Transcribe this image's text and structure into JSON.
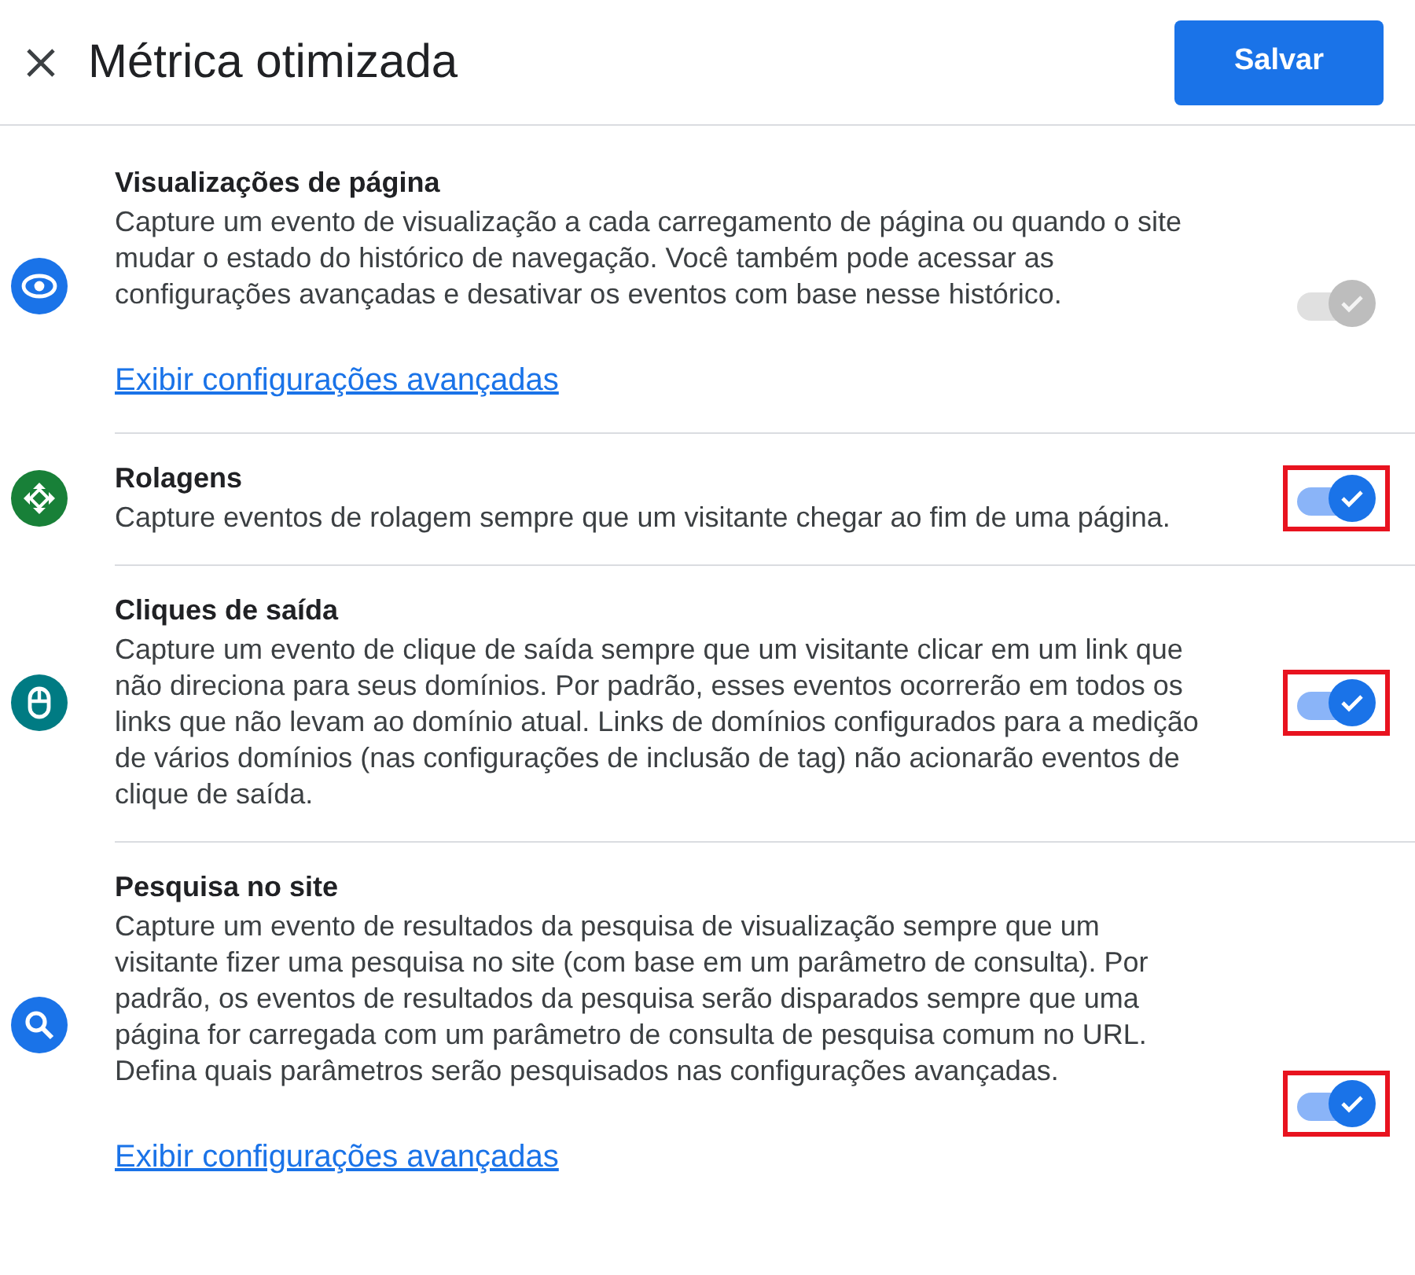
{
  "header": {
    "title": "Métrica otimizada",
    "save_button": "Salvar"
  },
  "items": [
    {
      "kind": "pageview",
      "title": "Visualizações de página",
      "description": "Capture um evento de visualização a cada carregamento de página ou quando o site mudar o estado do histórico de navegação. Você também pode acessar as configurações avançadas e desativar os eventos com base nesse histórico.",
      "link": "Exibir configurações avançadas",
      "on": true,
      "disabled": true,
      "highlighted": false
    },
    {
      "kind": "scroll",
      "title": "Rolagens",
      "description": "Capture eventos de rolagem sempre que um visitante chegar ao fim de uma página.",
      "on": true,
      "disabled": false,
      "highlighted": true
    },
    {
      "kind": "click",
      "title": "Cliques de saída",
      "description": "Capture um evento de clique de saída sempre que um visitante clicar em um link que não direciona para seus domínios. Por padrão, esses eventos ocorrerão em todos os links que não levam ao domínio atual. Links de domínios configurados para a medição de vários domínios (nas configurações de inclusão de tag) não acionarão eventos de clique de saída.",
      "on": true,
      "disabled": false,
      "highlighted": true
    },
    {
      "kind": "search",
      "title": "Pesquisa no site",
      "description": "Capture um evento de resultados da pesquisa de visualização sempre que um visitante fizer uma pesquisa no site (com base em um parâmetro de consulta). Por padrão, os eventos de resultados da pesquisa serão disparados sempre que uma página for carregada com um parâmetro de consulta de pesquisa comum no URL. Defina quais parâmetros serão pesquisados nas configurações avançadas.",
      "link": "Exibir configurações avançadas",
      "on": true,
      "disabled": false,
      "highlighted": true
    }
  ]
}
